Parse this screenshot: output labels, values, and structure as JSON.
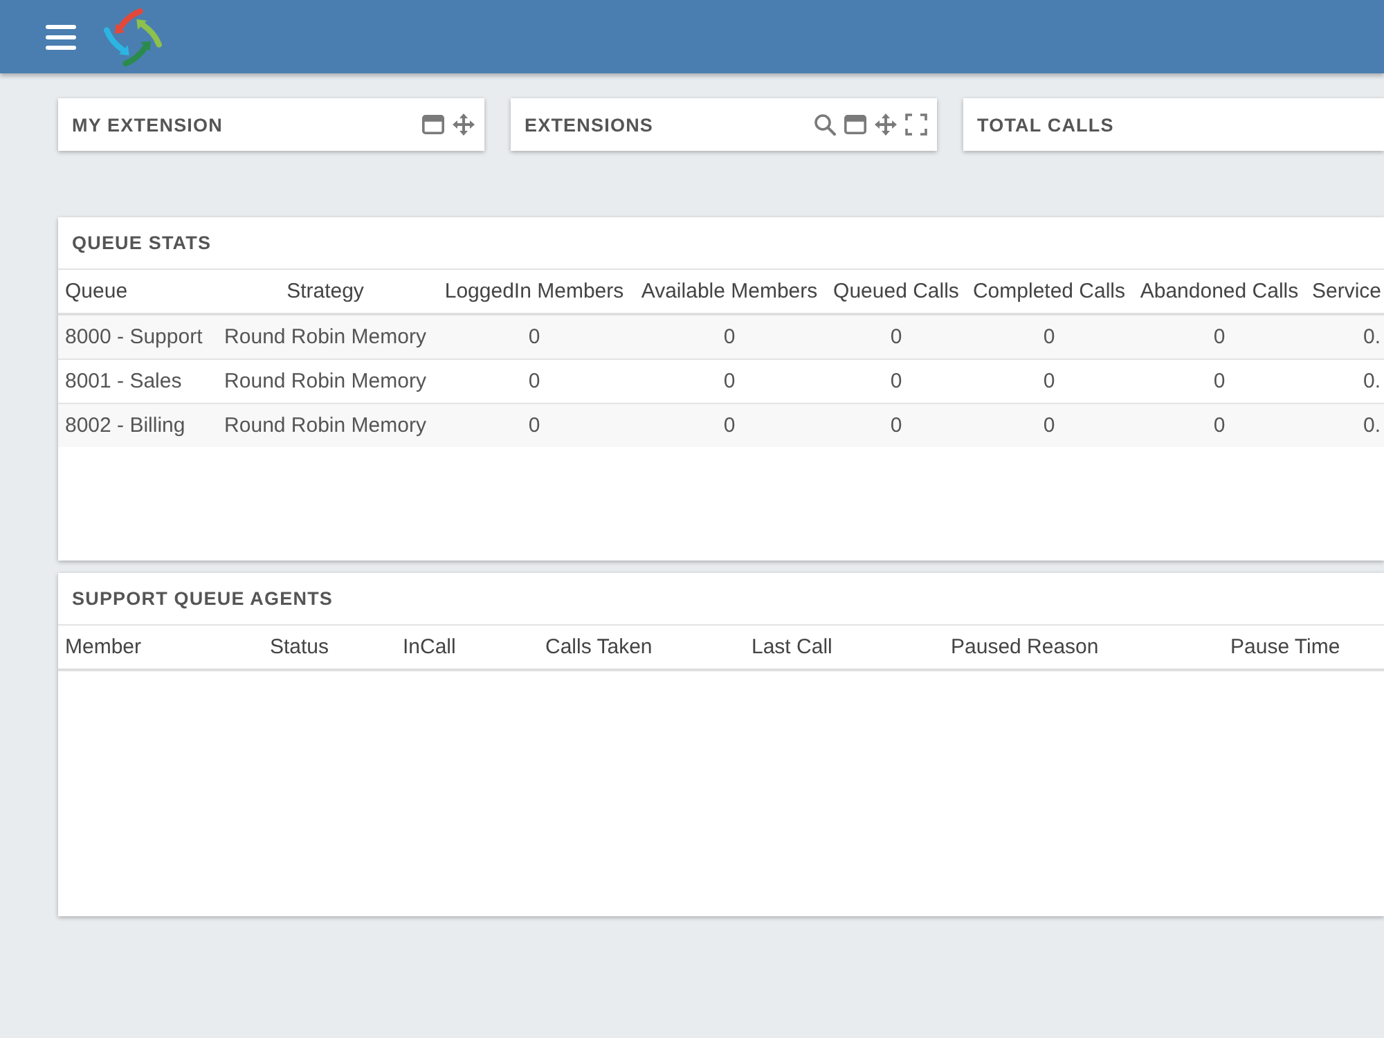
{
  "widgets": [
    {
      "title": "MY EXTENSION",
      "tools": [
        {
          "kind": "window"
        },
        {
          "kind": "move"
        }
      ]
    },
    {
      "title": "EXTENSIONS",
      "tools": [
        {
          "kind": "search"
        },
        {
          "kind": "window"
        },
        {
          "kind": "move"
        },
        {
          "kind": "fullscreen"
        }
      ]
    },
    {
      "title": "TOTAL CALLS"
    }
  ],
  "queue_stats": {
    "title": "QUEUE STATS",
    "columns": [
      "Queue",
      "Strategy",
      "LoggedIn Members",
      "Available Members",
      "Queued Calls",
      "Completed Calls",
      "Abandoned Calls",
      "Service"
    ],
    "rows": [
      [
        "8000 - Support",
        "Round Robin Memory",
        "0",
        "0",
        "0",
        "0",
        "0",
        "0."
      ],
      [
        "8001 - Sales",
        "Round Robin Memory",
        "0",
        "0",
        "0",
        "0",
        "0",
        "0."
      ],
      [
        "8002 - Billing",
        "Round Robin Memory",
        "0",
        "0",
        "0",
        "0",
        "0",
        "0."
      ]
    ]
  },
  "support_queue_agents": {
    "title": "SUPPORT QUEUE AGENTS",
    "columns": [
      "Member",
      "Status",
      "InCall",
      "Calls Taken",
      "Last Call",
      "Paused Reason",
      "Pause Time"
    ]
  }
}
